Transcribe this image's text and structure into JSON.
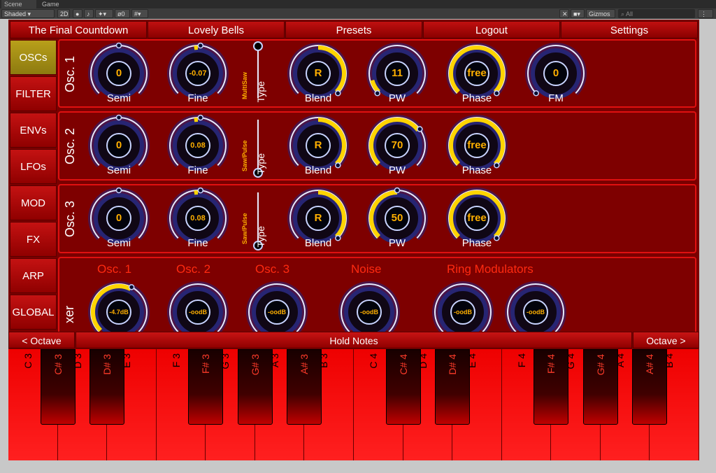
{
  "editor": {
    "tabs": [
      "Scene",
      "Game"
    ],
    "draw_mode": "Shaded",
    "view_2d": "2D",
    "gizmos": "Gizmos",
    "search_placeholder": "All",
    "overlay_count": "0"
  },
  "top_bar": [
    "The Final Countdown",
    "Lovely Bells",
    "Presets",
    "Logout",
    "Settings"
  ],
  "nav": {
    "items": [
      "OSCs",
      "FILTER",
      "ENVs",
      "LFOs",
      "MOD",
      "FX",
      "ARP",
      "GLOBAL"
    ],
    "active": "OSCs"
  },
  "oscillators": [
    {
      "label": "Osc. 1",
      "semi": {
        "value": "0",
        "label": "Semi"
      },
      "fine": {
        "value": "-0.07",
        "label": "Fine"
      },
      "type": {
        "wave": "MultiSaw",
        "label": "Type"
      },
      "blend": {
        "value": "R",
        "label": "Blend"
      },
      "pw": {
        "value": "11",
        "label": "PW"
      },
      "phase": {
        "value": "free",
        "label": "Phase"
      },
      "fm": {
        "value": "0",
        "label": "FM"
      }
    },
    {
      "label": "Osc. 2",
      "semi": {
        "value": "0",
        "label": "Semi"
      },
      "fine": {
        "value": "0.08",
        "label": "Fine"
      },
      "type": {
        "wave": "Saw/Pulse",
        "label": "Type"
      },
      "blend": {
        "value": "R",
        "label": "Blend"
      },
      "pw": {
        "value": "70",
        "label": "PW"
      },
      "phase": {
        "value": "free",
        "label": "Phase"
      }
    },
    {
      "label": "Osc. 3",
      "semi": {
        "value": "0",
        "label": "Semi"
      },
      "fine": {
        "value": "0.08",
        "label": "Fine"
      },
      "type": {
        "wave": "Saw/Pulse",
        "label": "Type"
      },
      "blend": {
        "value": "R",
        "label": "Blend"
      },
      "pw": {
        "value": "50",
        "label": "PW"
      },
      "phase": {
        "value": "free",
        "label": "Phase"
      }
    }
  ],
  "mixer": {
    "label": "xer",
    "headers": [
      "Osc. 1",
      "Osc. 2",
      "Osc. 3",
      "Noise",
      "Ring Modulators"
    ],
    "levels": [
      "-4.7dB",
      "-oodB",
      "-oodB",
      "-oodB",
      "-oodB",
      "-oodB"
    ]
  },
  "keyboard": {
    "octave_down": "< Octave",
    "hold": "Hold Notes",
    "octave_up": "Octave >",
    "white_keys": [
      "C 3",
      "D 3",
      "E 3",
      "F 3",
      "G 3",
      "A 3",
      "B 3",
      "C 4",
      "D 4",
      "E 4",
      "F 4",
      "G 4",
      "A 4",
      "B 4"
    ],
    "black_keys": [
      "C# 3",
      "D# 3",
      "F# 3",
      "G# 3",
      "A# 3",
      "C# 4",
      "D# 4",
      "F# 4",
      "G# 4",
      "A# 4"
    ]
  },
  "colors": {
    "panel": "#7e0000",
    "accent": "#ffd000",
    "active_nav": "#b8a01a",
    "ring": "#c8d4ff"
  }
}
